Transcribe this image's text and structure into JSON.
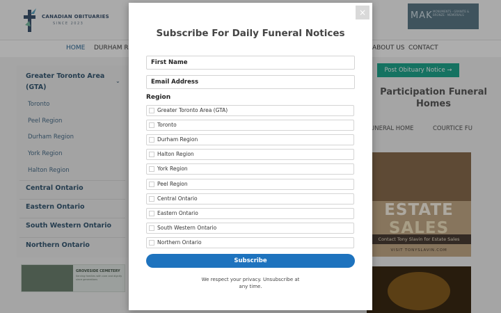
{
  "header": {
    "logo_name": "CANADIAN OBITUARIES",
    "logo_since": "SINCE 2023",
    "ad_text": "MAK",
    "ad_subtext": "MONUMENTS · GRANITE & BRONZE · MEMORIALS"
  },
  "nav": {
    "items": [
      "HOME",
      "DURHAM RE",
      "ABOUT US",
      "CONTACT"
    ]
  },
  "sidebar": {
    "group_gta": "Greater Toronto Area (GTA)",
    "sub_items": [
      "Toronto",
      "Peel Region",
      "Durham Region",
      "York Region",
      "Halton Region"
    ],
    "groups": [
      "Central Ontario",
      "Eastern Ontario",
      "South Western Ontario",
      "Northern Ontario"
    ],
    "ad_title": "GROVESIDE CEMETERY",
    "ad_sub": "Serving families with care and dignity since generations"
  },
  "right": {
    "post_button": "Post Obituary Notice →",
    "participation_title": "Participation Funeral Homes",
    "tab1": "UNERAL HOME",
    "tab2": "COURTICE FU",
    "estate_word1": "ESTATE",
    "estate_word2": "SALES",
    "estate_band": "Contact Tony Slavin for Estate Sales",
    "estate_site": "VISIT TONYSLAVIN.COM"
  },
  "modal": {
    "close": "×",
    "title": "Subscribe For Daily Funeral Notices",
    "first_name_placeholder": "First Name",
    "email_placeholder": "Email Address",
    "region_label": "Region",
    "regions": [
      "Greater Toronto Area (GTA)",
      "Toronto",
      "Durham Region",
      "Halton Region",
      "York Region",
      "Peel Region",
      "Central Ontario",
      "Eastern Ontario",
      "South Western Ontario",
      "Northern Ontario"
    ],
    "submit": "Subscribe",
    "privacy": "We respect your privacy. Unsubscribe at any time."
  },
  "colors": {
    "accent": "#1e73be",
    "post_button": "#20a88f",
    "sidebar_text": "#375a75"
  }
}
